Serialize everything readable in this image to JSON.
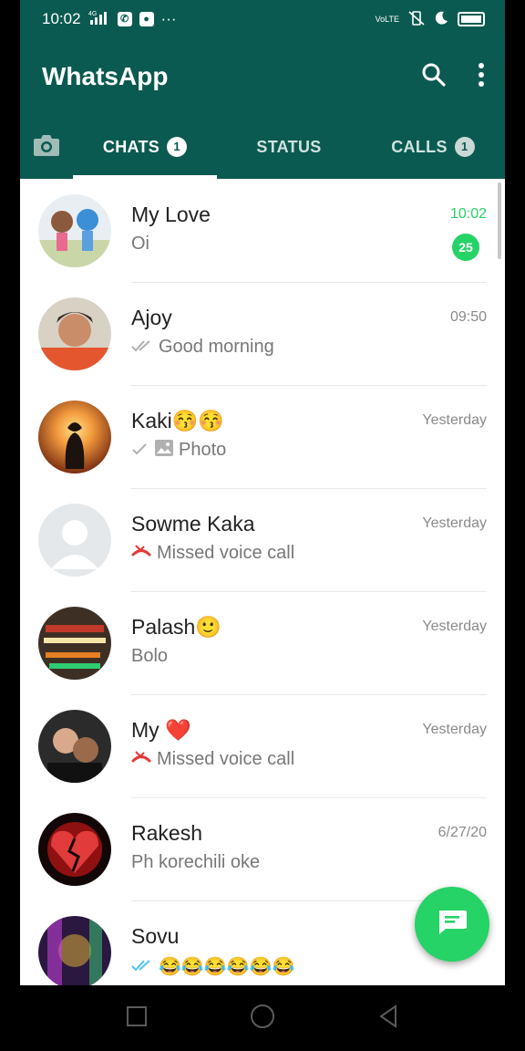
{
  "status_bar": {
    "time": "10:02",
    "network": "4G",
    "lte": "VoLTE"
  },
  "app": {
    "title": "WhatsApp"
  },
  "tabs": [
    {
      "label": "CHATS",
      "badge": "1"
    },
    {
      "label": "STATUS",
      "badge": ""
    },
    {
      "label": "CALLS",
      "badge": "1"
    }
  ],
  "chats": [
    {
      "name": "My Love",
      "time": "10:02",
      "preview": "Oi",
      "unread": "25"
    },
    {
      "name": "Ajoy",
      "time": "09:50",
      "preview": "Good  morning"
    },
    {
      "name": "Kaki😚😚",
      "time": "Yesterday",
      "preview": "Photo"
    },
    {
      "name": "Sowme Kaka",
      "time": "Yesterday",
      "preview": "Missed voice call"
    },
    {
      "name": "Palash🙂",
      "time": "Yesterday",
      "preview": "Bolo"
    },
    {
      "name": "My ❤️",
      "time": "Yesterday",
      "preview": "Missed voice call"
    },
    {
      "name": "Rakesh",
      "time": "6/27/20",
      "preview": "Ph korechili oke"
    },
    {
      "name": "Sovu",
      "time": "",
      "preview": "😂😂😂😂😂😂"
    }
  ],
  "colors": {
    "header": "#0b5a51",
    "accent": "#25d366",
    "missed": "#e53935"
  },
  "icons": [
    "camera-icon",
    "search-icon",
    "more-vert-icon",
    "double-tick-icon",
    "single-tick-icon",
    "photo-icon",
    "missed-call-icon",
    "new-chat-icon"
  ]
}
